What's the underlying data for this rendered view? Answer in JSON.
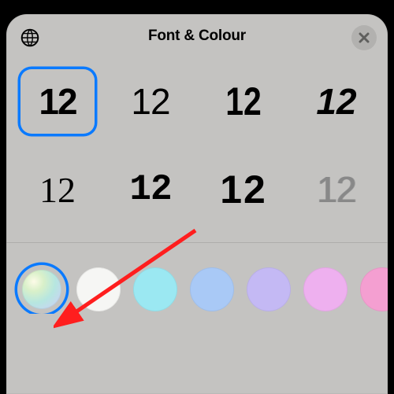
{
  "header": {
    "title": "Font & Colour",
    "globe_name": "globe-icon",
    "close_name": "close-icon"
  },
  "fonts": {
    "sample": "12",
    "selected_index": 0,
    "count": 8
  },
  "colours": {
    "selected_index": 0,
    "items": [
      {
        "name": "multicolour",
        "css": "radial-gradient(circle at 30% 30%, #fdfbe8 0%, #d9f0c9 25%, #b6e6e0 55%, #c6d7ef 80%, #d9c9ea 100%)"
      },
      {
        "name": "white",
        "css": "#f6f6f4"
      },
      {
        "name": "cyan",
        "css": "#9be8f2"
      },
      {
        "name": "light-blue",
        "css": "#a9c9f6"
      },
      {
        "name": "lavender",
        "css": "#c4b9f4"
      },
      {
        "name": "pink",
        "css": "#eeb0ef"
      },
      {
        "name": "magenta",
        "css": "#f49fd1"
      }
    ]
  },
  "annotation": {
    "type": "arrow",
    "target": "colour-swatch-0"
  }
}
